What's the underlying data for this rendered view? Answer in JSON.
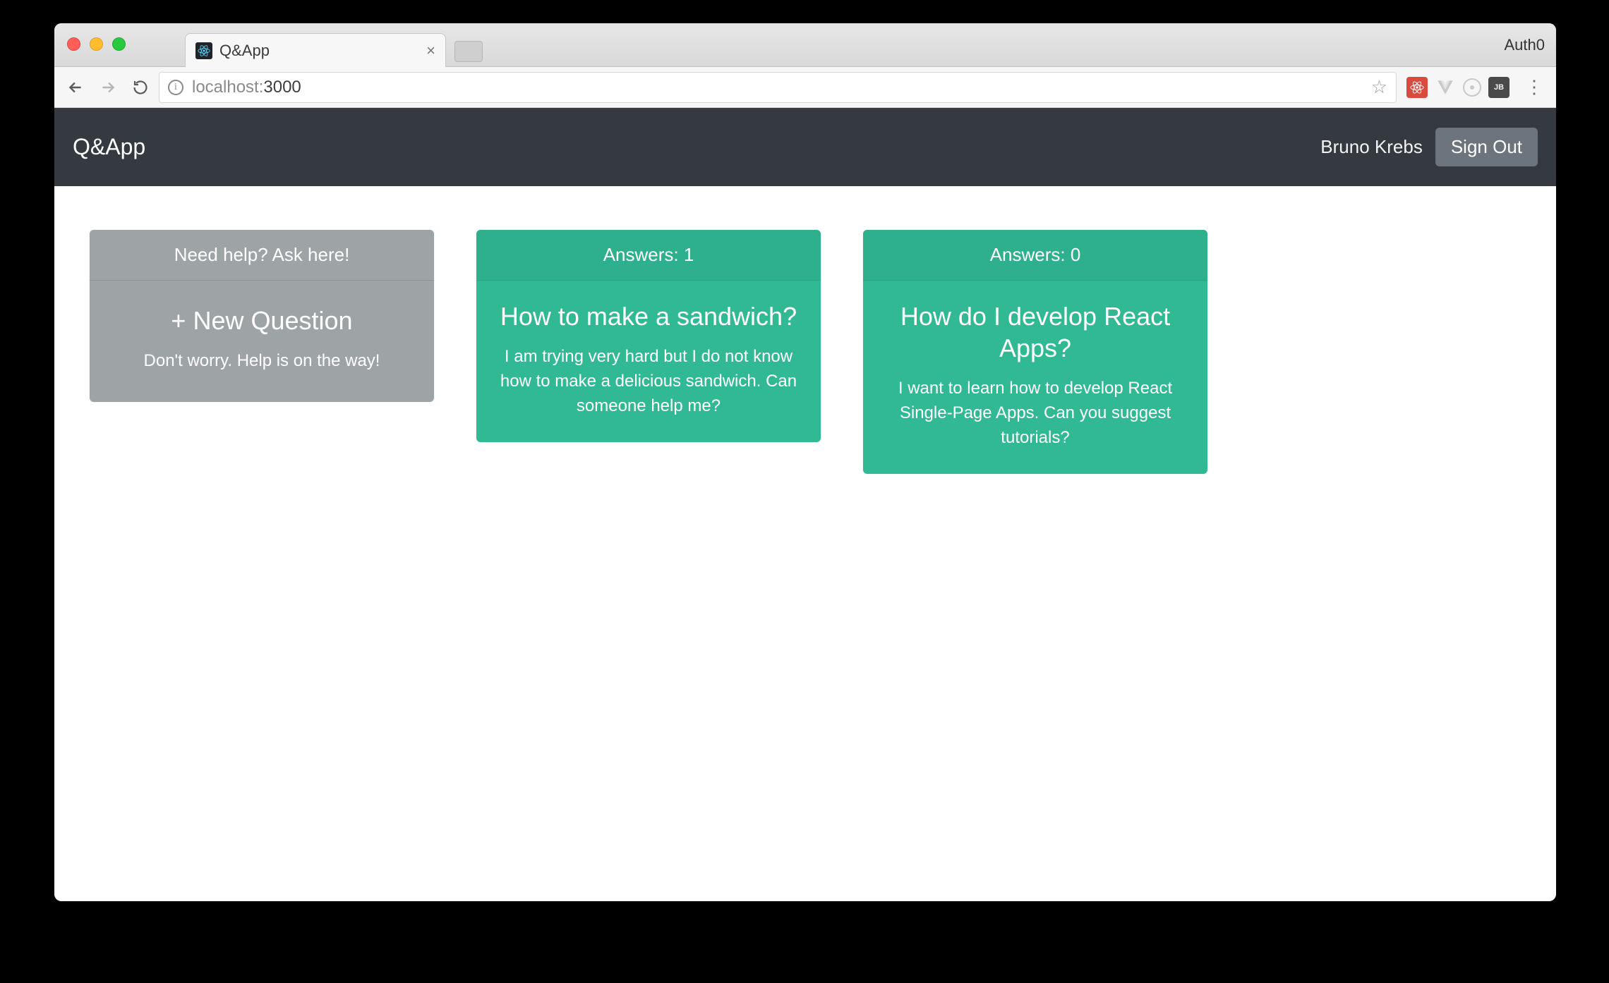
{
  "browser": {
    "tab_title": "Q&App",
    "profile_label": "Auth0",
    "url_host": "localhost:",
    "url_port": "3000"
  },
  "nav": {
    "brand": "Q&App",
    "username": "Bruno Krebs",
    "signout_label": "Sign Out"
  },
  "new_question_card": {
    "header": "Need help? Ask here!",
    "title": "+ New Question",
    "desc": "Don't worry. Help is on the way!"
  },
  "answers_label_prefix": "Answers: ",
  "questions": [
    {
      "answers": 1,
      "title": "How to make a sandwich?",
      "desc": "I am trying very hard but I do not know how to make a delicious sandwich. Can someone help me?"
    },
    {
      "answers": 0,
      "title": "How do I develop React Apps?",
      "desc": "I want to learn how to develop React Single-Page Apps. Can you suggest tutorials?"
    }
  ]
}
